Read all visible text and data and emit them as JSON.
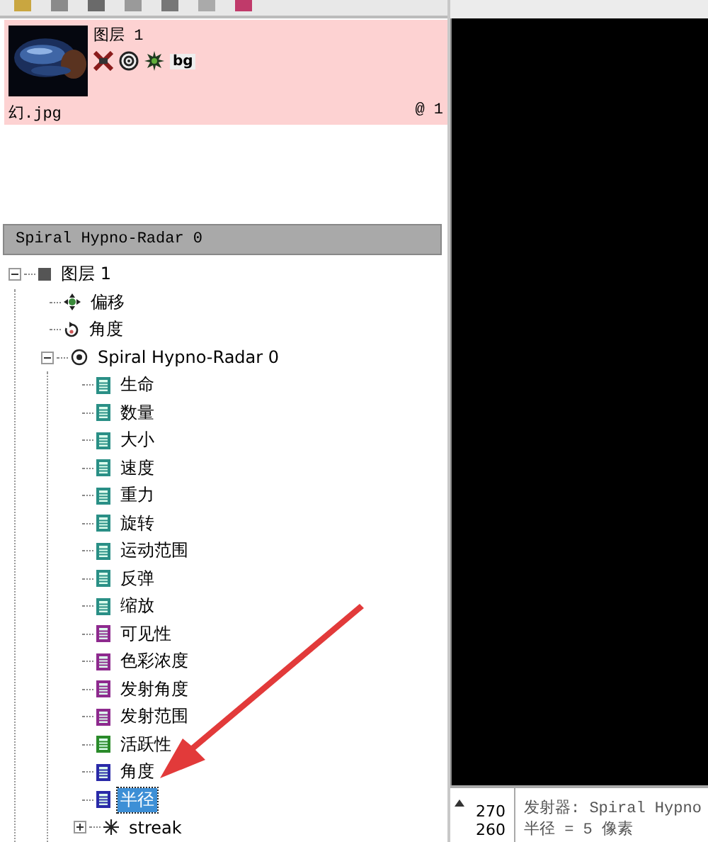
{
  "layer_card": {
    "title": "图层 1",
    "bg_label": "bg",
    "file": "幻.jpg",
    "index": "@ 1",
    "selected": true
  },
  "panel_header": "Spiral Hypno-Radar 0",
  "tree": [
    {
      "label": "图层 1",
      "kind": "layer",
      "expanded": true,
      "selected": false,
      "children": [
        {
          "label": "偏移",
          "kind": "move",
          "selected": false
        },
        {
          "label": "角度",
          "kind": "rotate",
          "selected": false
        },
        {
          "label": "Spiral Hypno-Radar 0",
          "kind": "emitter",
          "expanded": true,
          "selected": false,
          "children": [
            {
              "label": "生命",
              "kind": "param",
              "color": "#2a8f86",
              "selected": false
            },
            {
              "label": "数量",
              "kind": "param",
              "color": "#2a8f86",
              "selected": false
            },
            {
              "label": "大小",
              "kind": "param",
              "color": "#2a8f86",
              "selected": false
            },
            {
              "label": "速度",
              "kind": "param",
              "color": "#2a8f86",
              "selected": false
            },
            {
              "label": "重力",
              "kind": "param",
              "color": "#2a8f86",
              "selected": false
            },
            {
              "label": "旋转",
              "kind": "param",
              "color": "#2a8f86",
              "selected": false
            },
            {
              "label": "运动范围",
              "kind": "param",
              "color": "#2a8f86",
              "selected": false
            },
            {
              "label": "反弹",
              "kind": "param",
              "color": "#2a8f86",
              "selected": false
            },
            {
              "label": "缩放",
              "kind": "param",
              "color": "#2a8f86",
              "selected": false
            },
            {
              "label": "可见性",
              "kind": "param",
              "color": "#8e2a8e",
              "selected": false
            },
            {
              "label": "色彩浓度",
              "kind": "param",
              "color": "#8e2a8e",
              "selected": false
            },
            {
              "label": "发射角度",
              "kind": "param",
              "color": "#8e2a8e",
              "selected": false
            },
            {
              "label": "发射范围",
              "kind": "param",
              "color": "#8e2a8e",
              "selected": false
            },
            {
              "label": "活跃性",
              "kind": "param",
              "color": "#2a8a2a",
              "selected": false
            },
            {
              "label": "角度",
              "kind": "param",
              "color": "#2a2aa8",
              "selected": false
            },
            {
              "label": "半径",
              "kind": "param",
              "color": "#2a2aa8",
              "selected": true
            },
            {
              "label": "streak",
              "kind": "star",
              "expanded": false,
              "selected": false
            }
          ]
        }
      ]
    }
  ],
  "info_panel": {
    "ruler": [
      "270",
      "260"
    ],
    "lines": [
      "发射器: Spiral Hypno",
      "半径 = 5 像素"
    ]
  }
}
